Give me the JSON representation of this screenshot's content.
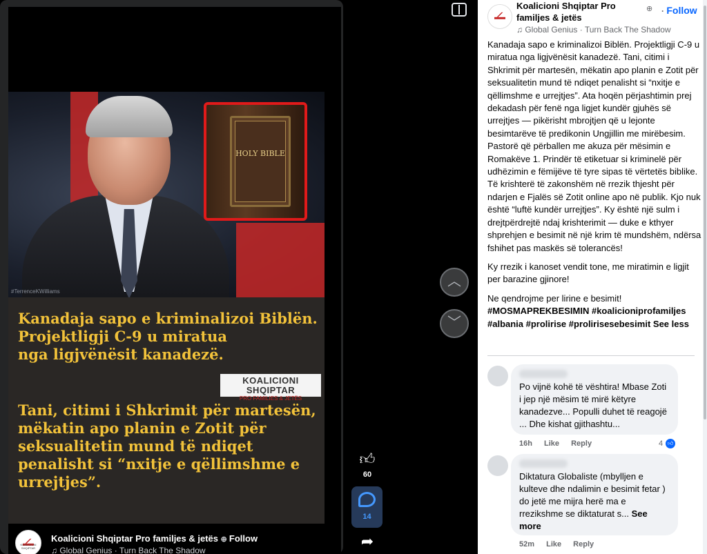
{
  "reel": {
    "watermark": "#TerrenceKWilliams",
    "bible_label": "HOLY BIBLE",
    "headline_top": "Kanadaja sapo e kriminalizoi Biblën.\nProjektligji C-9 u miratua\nnga ligjvënësit kanadezë.",
    "logo_main": "KOALICIONI SHQIPTAR",
    "logo_sub": "PRO FAMILIES & JETËS",
    "headline_bottom": "Tani, citimi i Shkrimit për martesën,\nmëkatin apo planin e Zotit për\nseksualitetin mund të ndiqet\npenalisht si “nxitje e qëllimshme e\nurrejtjes”.",
    "footer_name": "Koalicioni Shqiptar Pro familjes & jetës",
    "footer_follow": "Follow",
    "footer_audio": "♫ Global Genius · Turn Back The Shadow",
    "avatar_text": "KOALICIONI SHQIPTAR"
  },
  "rail": {
    "likes": "60",
    "comments": "14"
  },
  "post": {
    "page_name": "Koalicioni Shqiptar Pro familjes & jetës",
    "follow": "Follow",
    "audio": "♫ Global Genius · Turn Back The Shadow",
    "para1": "Kanadaja sapo e kriminalizoi Biblën. Projektligji C-9 u miratua nga ligjvënësit kanadezë. Tani, citimi i Shkrimit për martesën, mëkatin apo planin e Zotit për seksualitetin mund të ndiqet penalisht si “nxitje e qëllimshme e urrejtjes”. Ata hoqën përjashtimin prej dekadash për fenë nga ligjet kundër gjuhës së urrejtjes — pikërisht mbrojtjen që u lejonte besimtarëve të predikonin Ungjillin me mirëbesim. Pastorë që përballen me akuza për mësimin e Romakëve 1. Prindër të etiketuar si kriminelë për udhëzimin e fëmijëve të tyre sipas të vërtetës biblike. Të krishterë të zakonshëm në rrezik thjesht për ndarjen e Fjalës së Zotit online apo në publik. Kjo nuk është “luftë kundër urrejtjes”. Ky është një sulm i drejtpërdrejtë ndaj krishterimit — duke e kthyer shprehjen e besimit në një krim të mundshëm, ndërsa fshihet pas maskës së tolerancës!",
    "para2": "Ky rrezik i kanoset vendit tone, me miratimin e ligjit per barazine gjinore!",
    "para3": "Ne qendrojme per lirine e besimit!",
    "tags": "#MOSMAPREKBESIMIN #koalicioniprofamiljes #albania #prolirise #prolirisesebesimit",
    "see_less": "See less"
  },
  "comments": [
    {
      "text": "Po vijnë kohë të vështira! Mbase Zoti i jep një mësim të mirë këtyre kanadezve... Populli duhet të reagojë ... Dhe kishat gjithashtu...",
      "time": "16h",
      "like": "Like",
      "reply": "Reply",
      "reactions": "4"
    },
    {
      "text": "Diktatura Globaliste (mbylljen e kulteve dhe ndalimin e besimit fetar ) do jetë me mijra herë ma e rrezikshme se diktaturat s...",
      "see_more": "See more",
      "time": "52m",
      "like": "Like",
      "reply": "Reply"
    }
  ],
  "colors": {
    "accent": "#0866ff",
    "headline": "#f2c23a",
    "bible_frame": "#e01a1a"
  }
}
